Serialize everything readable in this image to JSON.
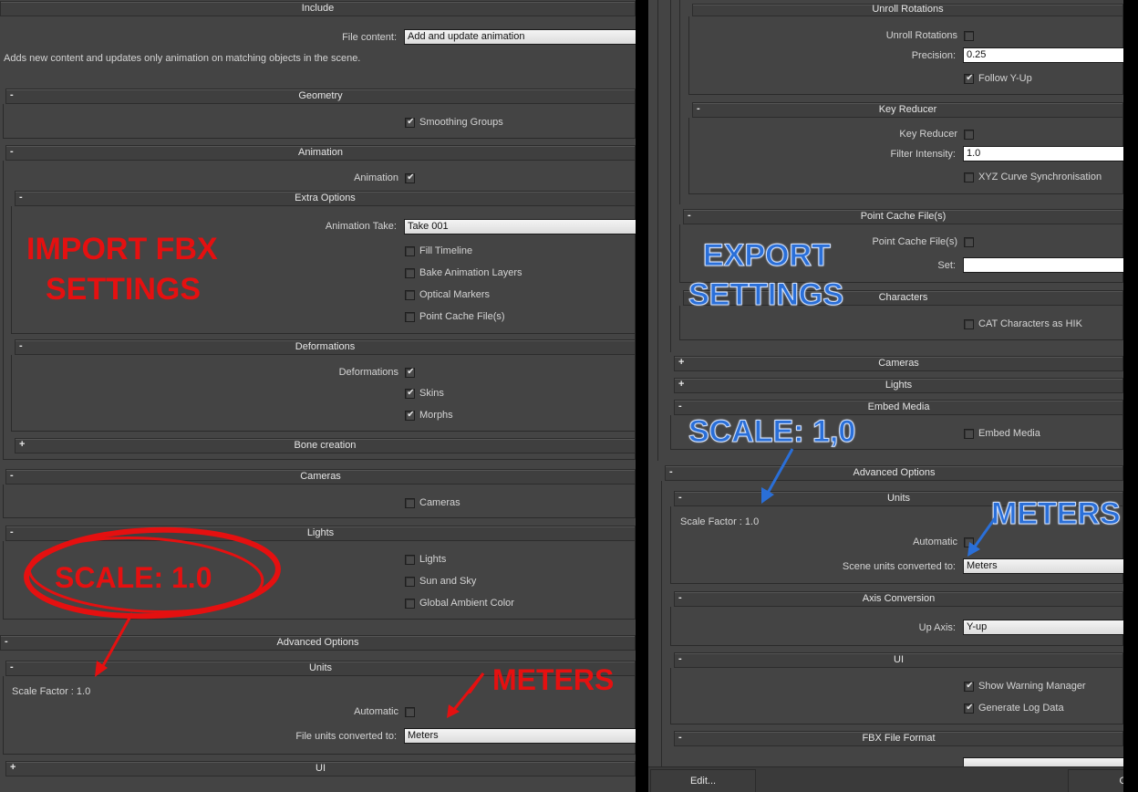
{
  "import": {
    "include": {
      "title": "Include",
      "file_content_label": "File content:",
      "file_content_value": "Add and update animation",
      "description": "Adds new content and updates only animation on matching objects in the scene."
    },
    "geometry": {
      "title": "Geometry",
      "sign": "-",
      "smoothing_groups": "Smoothing Groups"
    },
    "animation": {
      "title": "Animation",
      "sign": "-",
      "animation_label": "Animation",
      "extra_options": {
        "title": "Extra Options",
        "sign": "-",
        "take_label": "Animation Take:",
        "take_value": "Take 001",
        "fill_timeline": "Fill Timeline",
        "bake_layers": "Bake Animation Layers",
        "optical_markers": "Optical Markers",
        "point_cache": "Point Cache File(s)"
      },
      "deformations": {
        "title": "Deformations",
        "sign": "-",
        "deformations_label": "Deformations",
        "skins": "Skins",
        "morphs": "Morphs"
      },
      "bone_creation": {
        "title": "Bone creation",
        "sign": "+"
      }
    },
    "cameras": {
      "title": "Cameras",
      "sign": "-",
      "cameras_label": "Cameras"
    },
    "lights": {
      "title": "Lights",
      "sign": "-",
      "lights": "Lights",
      "sun_sky": "Sun and Sky",
      "global_ambient": "Global Ambient Color"
    },
    "advanced": {
      "title": "Advanced Options",
      "sign": "-",
      "units": {
        "title": "Units",
        "sign": "-",
        "scale_factor": "Scale Factor : 1.0",
        "automatic": "Automatic",
        "converted_label": "File units converted to:",
        "converted_value": "Meters"
      }
    },
    "ui": {
      "title": "UI",
      "sign": "+"
    }
  },
  "export": {
    "unroll": {
      "title": "Unroll Rotations",
      "unroll_label": "Unroll Rotations",
      "precision_label": "Precision:",
      "precision_value": "0.25",
      "follow_y_up": "Follow Y-Up"
    },
    "key_reducer": {
      "title": "Key Reducer",
      "sign": "-",
      "key_reducer_label": "Key Reducer",
      "filter_label": "Filter Intensity:",
      "filter_value": "1.0",
      "xyz_sync": "XYZ Curve Synchronisation"
    },
    "point_cache": {
      "title": "Point Cache File(s)",
      "sign": "-",
      "label": "Point Cache File(s)",
      "set_label": "Set:",
      "set_value": ""
    },
    "characters": {
      "title": "Characters",
      "cat_hik": "CAT Characters as HIK"
    },
    "cameras": {
      "title": "Cameras",
      "sign": "+"
    },
    "lights": {
      "title": "Lights",
      "sign": "+"
    },
    "embed_media": {
      "title": "Embed Media",
      "sign": "-",
      "label": "Embed Media"
    },
    "advanced": {
      "title": "Advanced Options",
      "sign": "-",
      "units": {
        "title": "Units",
        "sign": "-",
        "scale_factor": "Scale Factor : 1.0",
        "automatic": "Automatic",
        "converted_label": "Scene units converted to:",
        "converted_value": "Meters"
      },
      "axis": {
        "title": "Axis Conversion",
        "sign": "-",
        "up_axis_label": "Up Axis:",
        "up_axis_value": "Y-up"
      },
      "ui": {
        "title": "UI",
        "sign": "-",
        "show_warning": "Show Warning Manager",
        "generate_log": "Generate Log Data"
      },
      "fbx_format": {
        "title": "FBX File Format",
        "sign": "-"
      }
    },
    "buttons": {
      "edit": "Edit...",
      "ok": "O"
    }
  },
  "annotations": {
    "import_title_line1": "IMPORT FBX",
    "import_title_line2": "SETTINGS",
    "import_scale": "SCALE: 1.0",
    "import_meters": "METERS",
    "export_title_line1": "EXPORT",
    "export_title_line2": "SETTINGS",
    "export_scale": "SCALE: 1,0",
    "export_meters": "METERS",
    "red": "#e51010",
    "blue": "#2a6fd8"
  },
  "colors": {
    "panel_bg": "#444444",
    "bar_bg": "#3f3f3f",
    "field_bg": "#e8e8e8"
  }
}
